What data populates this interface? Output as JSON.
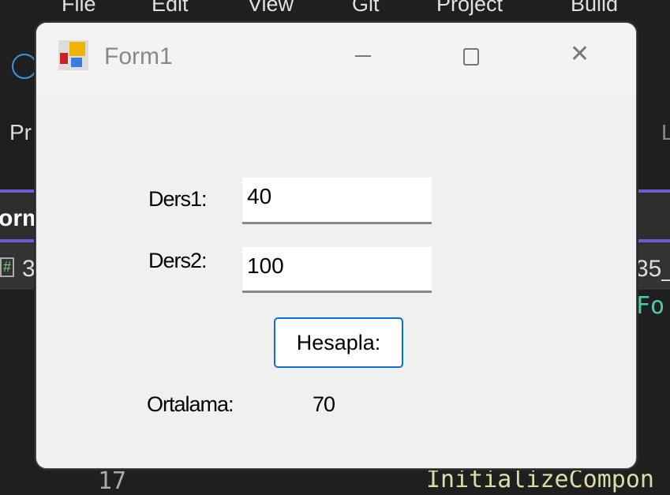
{
  "ide": {
    "menu": [
      "File",
      "Edit",
      "View",
      "Git",
      "Project",
      "Build"
    ],
    "partial_left_toolbar": "Pr",
    "partial_tab": "orm",
    "partial_row_left": "3",
    "partial_row_right": "35_",
    "partial_code_right": "Fo",
    "line_number": "17",
    "code": "InitializeCompon",
    "partial_toolbar_right": "L"
  },
  "form": {
    "title": "Form1",
    "label1": "Ders1:",
    "value1": "40",
    "label2": "Ders2:",
    "value2": "100",
    "button": "Hesapla:",
    "result_label": "Ortalama:",
    "result_value": "70"
  }
}
